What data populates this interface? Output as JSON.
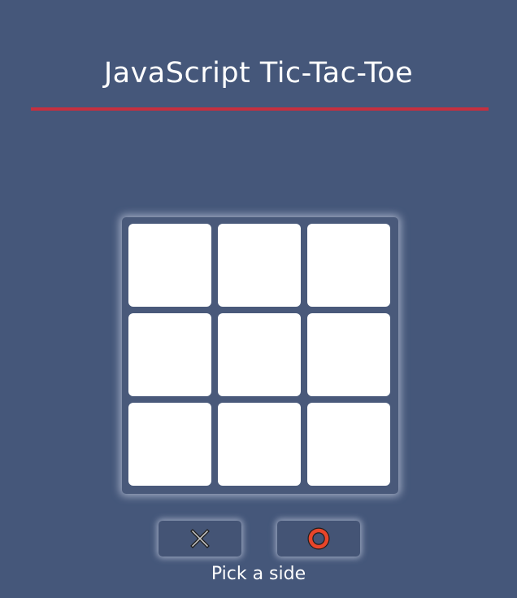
{
  "header": {
    "title": "JavaScript Tic-Tac-Toe"
  },
  "colors": {
    "background": "#45577a",
    "divider": "#c62f3f",
    "cell": "#ffffff",
    "x_marker_fill": "#c8c8c8",
    "o_marker_fill": "#e8452a"
  },
  "board": {
    "cells": [
      "",
      "",
      "",
      "",
      "",
      "",
      "",
      "",
      ""
    ]
  },
  "side_picker": {
    "options": [
      {
        "id": "x",
        "icon": "x-marker-icon"
      },
      {
        "id": "o",
        "icon": "o-marker-icon"
      }
    ],
    "prompt": "Pick a side"
  }
}
